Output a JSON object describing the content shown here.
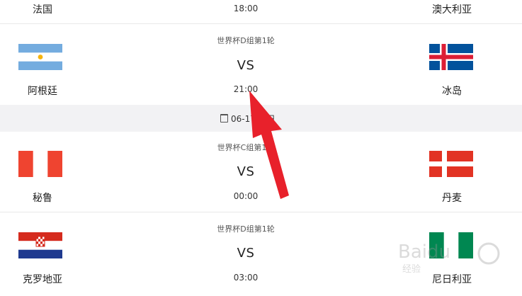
{
  "matches": [
    {
      "home": "法国",
      "away": "澳大利亚",
      "round": "",
      "vs": "",
      "time": "18:00"
    },
    {
      "home": "阿根廷",
      "away": "冰岛",
      "round": "世界杯D组第1轮",
      "vs": "VS",
      "time": "21:00"
    },
    {
      "home": "秘鲁",
      "away": "丹麦",
      "round": "世界杯C组第1轮",
      "vs": "VS",
      "time": "00:00"
    },
    {
      "home": "克罗地亚",
      "away": "尼日利亚",
      "round": "世界杯D组第1轮",
      "vs": "VS",
      "time": "03:00"
    }
  ],
  "date_bar": {
    "label": "06-17 周日"
  },
  "watermark": {
    "text": "Baidu 经验"
  },
  "colors": {
    "arrow": "#e8212b",
    "divider": "#e9e9e9",
    "date_bg": "#f2f2f4"
  }
}
